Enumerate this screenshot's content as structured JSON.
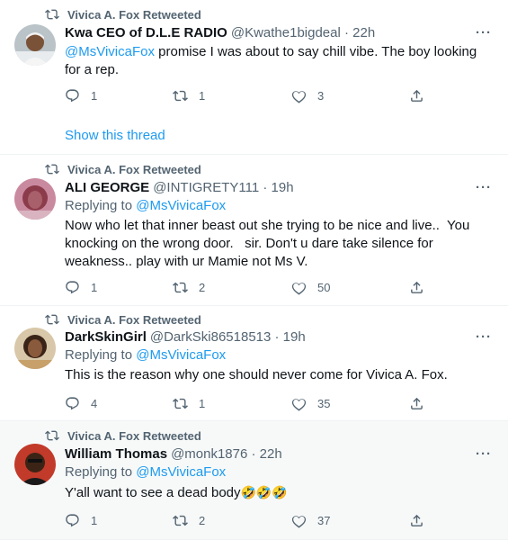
{
  "retweet_label": "Vivica A. Fox Retweeted",
  "more_label": "···",
  "replying_prefix": "Replying to ",
  "show_thread_label": "Show this thread",
  "colors": {
    "accent": "#1d9bf0",
    "muted": "#536471",
    "text": "#0f1419",
    "divider": "#eff3f4"
  },
  "icons": {
    "retweet": "retweet-icon",
    "reply": "reply-icon",
    "like": "heart-icon",
    "share": "share-icon",
    "more": "more-icon"
  },
  "tweets": [
    {
      "name": "Kwa CEO of D.L.E RADIO",
      "meta": "@Kwathe1bigdeal · 22h",
      "replying_to": "",
      "mention": "@MsVivicaFox",
      "text": " promise I was about to say chill vibe. The boy looking for a rep.",
      "counts": {
        "reply": "1",
        "retweet": "1",
        "like": "3"
      }
    },
    {
      "name": "ALI GEORGE",
      "meta": "@INTIGRETY111 · 19h",
      "replying_to": "@MsVivicaFox",
      "text": "Now who let that inner beast out she trying to be nice and live..  You knocking on the wrong door.   sir. Don't u dare take silence for weakness.. play with ur Mamie not Ms V.",
      "counts": {
        "reply": "1",
        "retweet": "2",
        "like": "50"
      }
    },
    {
      "name": "DarkSkinGirl",
      "meta": "@DarkSki86518513 · 19h",
      "replying_to": "@MsVivicaFox",
      "text": "This is the reason why one should never come for Vivica A. Fox.",
      "counts": {
        "reply": "4",
        "retweet": "1",
        "like": "35"
      }
    },
    {
      "name": "William Thomas",
      "meta": "@monk1876 · 22h",
      "replying_to": "@MsVivicaFox",
      "text": "Y'all want to see a dead body",
      "emoji": "🤣🤣🤣",
      "counts": {
        "reply": "1",
        "retweet": "2",
        "like": "37"
      }
    }
  ]
}
